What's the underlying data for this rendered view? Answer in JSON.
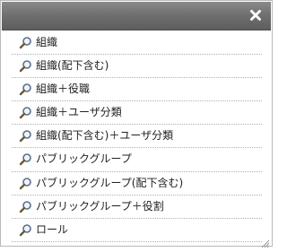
{
  "dialog": {
    "close_icon": "close-icon",
    "items": [
      {
        "label": "組織",
        "icon": "magnifier-icon"
      },
      {
        "label": "組織(配下含む)",
        "icon": "magnifier-icon"
      },
      {
        "label": "組織＋役職",
        "icon": "magnifier-icon"
      },
      {
        "label": "組織＋ユーザ分類",
        "icon": "magnifier-icon"
      },
      {
        "label": "組織(配下含む)＋ユーザ分類",
        "icon": "magnifier-icon"
      },
      {
        "label": "パブリックグループ",
        "icon": "magnifier-icon"
      },
      {
        "label": "パブリックグループ(配下含む)",
        "icon": "magnifier-icon"
      },
      {
        "label": "パブリックグループ＋役割",
        "icon": "magnifier-icon"
      },
      {
        "label": "ロール",
        "icon": "magnifier-icon"
      }
    ]
  },
  "colors": {
    "titlebar": "#6e6e6e",
    "text": "#222222",
    "divider": "#b0b0b0"
  }
}
